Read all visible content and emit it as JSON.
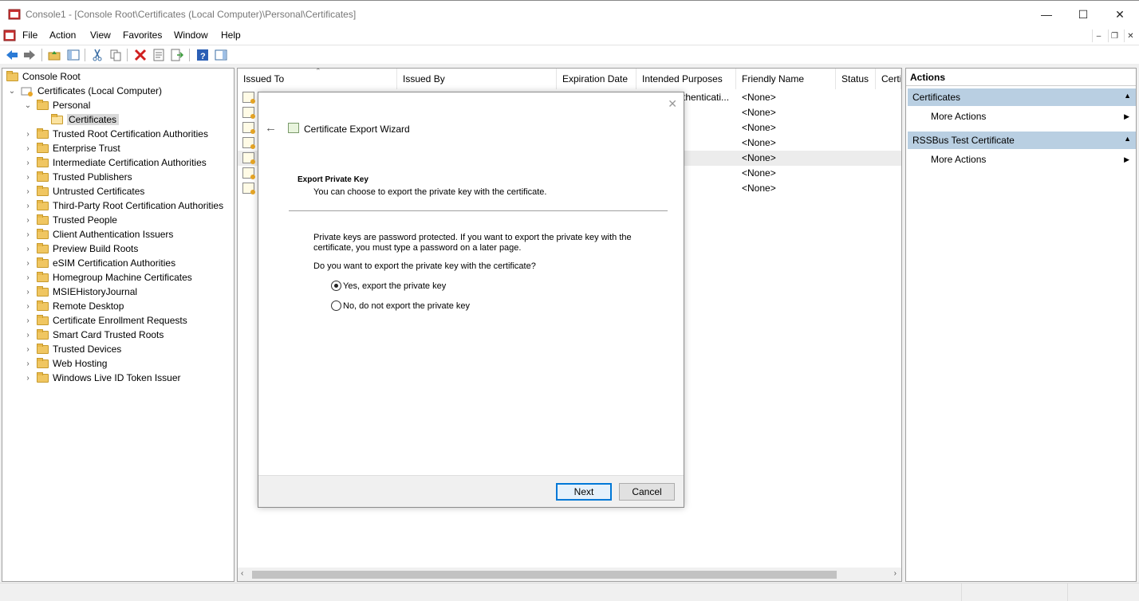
{
  "window": {
    "title": "Console1 - [Console Root\\Certificates (Local Computer)\\Personal\\Certificates]"
  },
  "menubar": {
    "items": [
      "File",
      "Action",
      "View",
      "Favorites",
      "Window",
      "Help"
    ]
  },
  "tree": {
    "root": "Console Root",
    "computer": "Certificates (Local Computer)",
    "personal": "Personal",
    "certificates": "Certificates",
    "stores": [
      "Trusted Root Certification Authorities",
      "Enterprise Trust",
      "Intermediate Certification Authorities",
      "Trusted Publishers",
      "Untrusted Certificates",
      "Third-Party Root Certification Authorities",
      "Trusted People",
      "Client Authentication Issuers",
      "Preview Build Roots",
      "eSIM Certification Authorities",
      "Homegroup Machine Certificates",
      "MSIEHistoryJournal",
      "Remote Desktop",
      "Certificate Enrollment Requests",
      "Smart Card Trusted Roots",
      "Trusted Devices",
      "Web Hosting",
      "Windows Live ID Token Issuer"
    ]
  },
  "list": {
    "columns": [
      "Issued To",
      "Issued By",
      "Expiration Date",
      "Intended Purposes",
      "Friendly Name",
      "Status",
      "Certi"
    ],
    "rows": [
      {
        "intended": "thenticati...",
        "friendly": "<None>"
      },
      {
        "intended": "",
        "friendly": "<None>"
      },
      {
        "intended": "",
        "friendly": "<None>"
      },
      {
        "intended": "",
        "friendly": "<None>"
      },
      {
        "intended": "",
        "friendly": "<None>"
      },
      {
        "intended": "",
        "friendly": "<None>"
      },
      {
        "intended": "",
        "friendly": "<None>"
      }
    ]
  },
  "actions": {
    "title": "Actions",
    "sections": [
      {
        "name": "Certificates",
        "item": "More Actions"
      },
      {
        "name": "RSSBus Test Certificate",
        "item": "More Actions"
      }
    ]
  },
  "dialog": {
    "title": "Certificate Export Wizard",
    "heading": "Export Private Key",
    "subheading": "You can choose to export the private key with the certificate.",
    "paragraph": "Private keys are password protected. If you want to export the private key with the certificate, you must type a password on a later page.",
    "question": "Do you want to export the private key with the certificate?",
    "options": [
      {
        "label": "Yes, export the private key",
        "selected": true
      },
      {
        "label": "No, do not export the private key",
        "selected": false
      }
    ],
    "next_label": "Next",
    "cancel_label": "Cancel"
  }
}
